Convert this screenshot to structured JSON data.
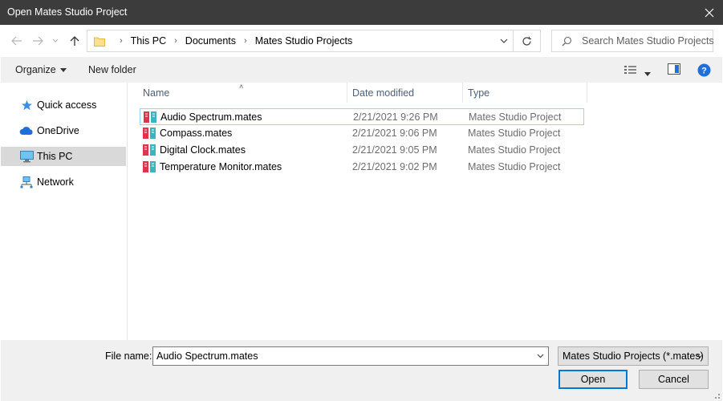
{
  "window": {
    "title": "Open Mates Studio Project"
  },
  "navigation": {
    "breadcrumbs": [
      "This PC",
      "Documents",
      "Mates Studio Projects"
    ],
    "search_placeholder": "Search Mates Studio Projects"
  },
  "toolbar": {
    "organize_label": "Organize",
    "new_folder_label": "New folder"
  },
  "sidebar": {
    "items": [
      {
        "label": "Quick access",
        "icon": "star-icon"
      },
      {
        "label": "OneDrive",
        "icon": "cloud-icon"
      },
      {
        "label": "This PC",
        "icon": "computer-icon",
        "selected": true
      },
      {
        "label": "Network",
        "icon": "network-icon"
      }
    ]
  },
  "file_list": {
    "columns": [
      "Name",
      "Date modified",
      "Type"
    ],
    "rows": [
      {
        "name": "Audio Spectrum.mates",
        "date": "2/21/2021 9:26 PM",
        "type": "Mates Studio Project",
        "selected": true
      },
      {
        "name": "Compass.mates",
        "date": "2/21/2021 9:06 PM",
        "type": "Mates Studio Project"
      },
      {
        "name": "Digital Clock.mates",
        "date": "2/21/2021 9:05 PM",
        "type": "Mates Studio Project"
      },
      {
        "name": "Temperature Monitor.mates",
        "date": "2/21/2021 9:02 PM",
        "type": "Mates Studio Project"
      }
    ]
  },
  "footer": {
    "file_name_label": "File name:",
    "file_name_value": "Audio Spectrum.mates",
    "filter_value": "Mates Studio Projects (*.mates)",
    "open_label": "Open",
    "cancel_label": "Cancel"
  },
  "colors": {
    "titlebar": "#3c3c3c",
    "accent": "#0078d7",
    "selection": "#99d1ff",
    "file_icon_red": "#e0344c",
    "file_icon_teal": "#3cb4c0"
  }
}
